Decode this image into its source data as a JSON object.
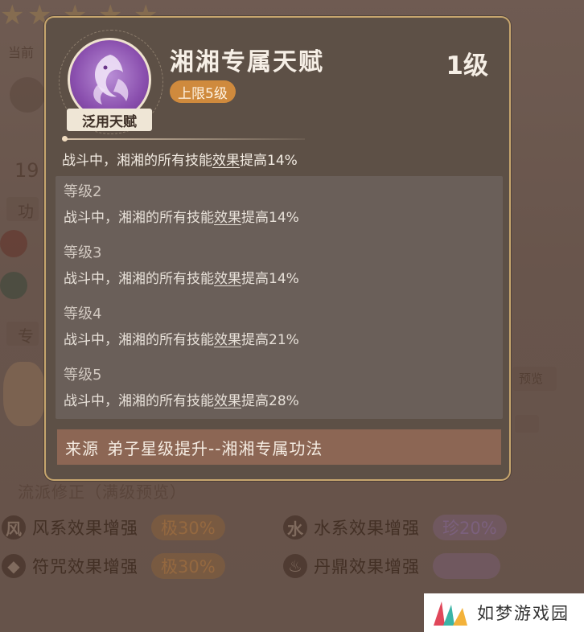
{
  "background": {
    "current_label": "当前",
    "value": "19",
    "section_tag_left": "功",
    "section_tag_left2": "专",
    "preview_tag": "预览",
    "faction_header": "流派修正（满级预览）",
    "effects": [
      {
        "icon": "风",
        "label": "风系效果增强",
        "grade": "极30%",
        "tone": "orange"
      },
      {
        "icon": "水",
        "label": "水系效果增强",
        "grade": "珍20%",
        "tone": "purple"
      },
      {
        "icon": "◆",
        "label": "符咒效果增强",
        "grade": "极30%",
        "tone": "orange"
      },
      {
        "icon": "♨",
        "label": "丹鼎效果增强",
        "grade": "",
        "tone": "purple"
      }
    ]
  },
  "popup": {
    "emblem_tag": "泛用天赋",
    "title": "湘湘专属天赋",
    "cap": "上限5级",
    "level": "1级",
    "current": {
      "pre": "战斗中，湘湘的所有技能",
      "link": "效果",
      "post": "提高14%"
    },
    "levels": [
      {
        "name": "等级2",
        "pre": "战斗中，湘湘的所有技能",
        "link": "效果",
        "post": "提高14%"
      },
      {
        "name": "等级3",
        "pre": "战斗中，湘湘的所有技能",
        "link": "效果",
        "post": "提高14%"
      },
      {
        "name": "等级4",
        "pre": "战斗中，湘湘的所有技能",
        "link": "效果",
        "post": "提高21%"
      },
      {
        "name": "等级5",
        "pre": "战斗中，湘湘的所有技能",
        "link": "效果",
        "post": "提高28%"
      }
    ],
    "source_label": "来源",
    "source_value": "弟子星级提升--湘湘专属功法"
  },
  "watermark": {
    "text": "如梦游戏园"
  },
  "colors": {
    "border": "#c7a66e",
    "panel": "#5d5046",
    "cap_badge": "#cf8a3d",
    "source_bar": "#8c6654",
    "emblem": "#8a4fae"
  }
}
